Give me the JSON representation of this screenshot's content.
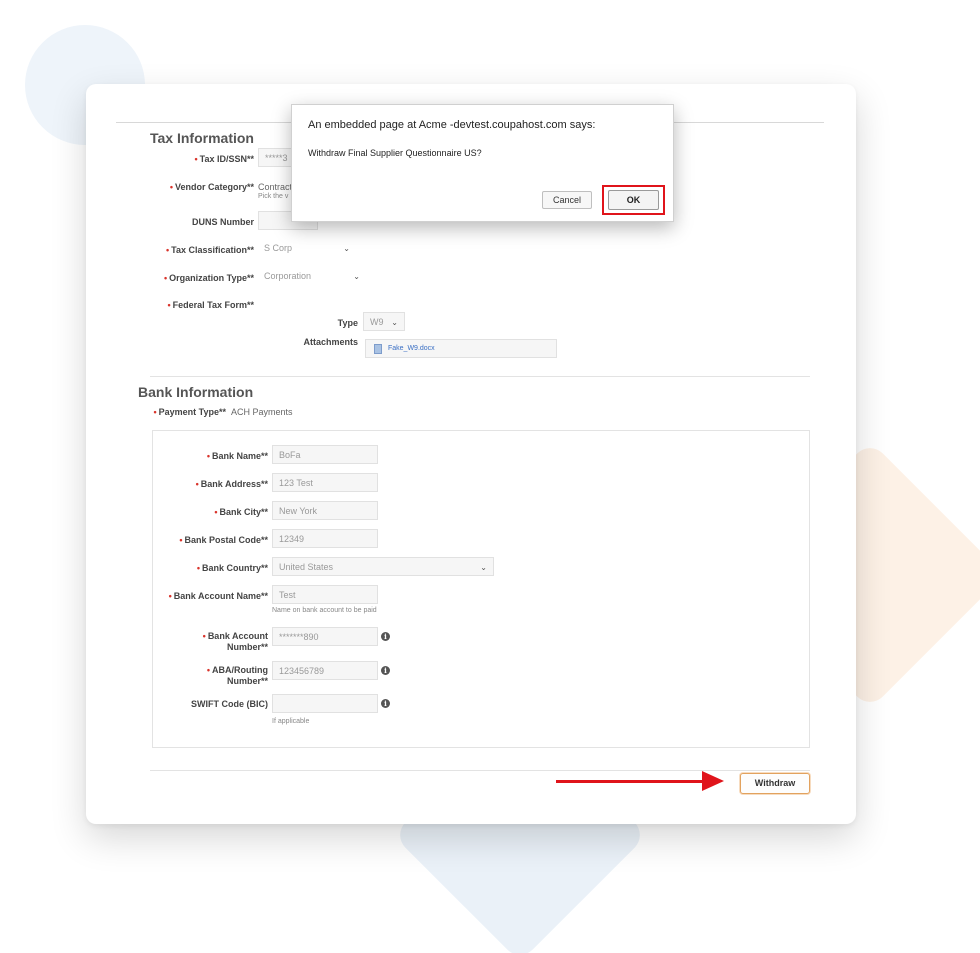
{
  "tax": {
    "title": "Tax Information",
    "tax_id_label": "Tax ID/SSN**",
    "tax_id_value": "*****3",
    "vendor_category_label": "Vendor Category**",
    "vendor_category_value": "Contract",
    "vendor_category_hint": "Pick the v",
    "duns_label": "DUNS Number",
    "duns_value": "",
    "tax_classification_label": "Tax Classification**",
    "tax_classification_value": "S Corp",
    "organization_type_label": "Organization Type**",
    "organization_type_value": "Corporation",
    "federal_tax_form_label": "Federal Tax Form**",
    "type_label": "Type",
    "type_value": "W9",
    "attachments_label": "Attachments",
    "attachment_file": "Fake_W9.docx"
  },
  "bank": {
    "title": "Bank Information",
    "payment_type_label": "Payment Type**",
    "payment_type_value": "ACH Payments",
    "bank_name_label": "Bank Name**",
    "bank_name_value": "BoFa",
    "bank_address_label": "Bank Address**",
    "bank_address_value": "123 Test",
    "bank_city_label": "Bank City**",
    "bank_city_value": "New York",
    "bank_postal_code_label": "Bank Postal Code**",
    "bank_postal_code_value": "12349",
    "bank_country_label": "Bank Country**",
    "bank_country_value": "United States",
    "bank_account_name_label": "Bank Account Name**",
    "bank_account_name_value": "Test",
    "bank_account_name_hint": "Name on bank account to be paid",
    "bank_account_number_label_1": "Bank Account",
    "bank_account_number_label_2": "Number**",
    "bank_account_number_value": "*******890",
    "aba_label_1": "ABA/Routing",
    "aba_label_2": "Number**",
    "aba_value": "123456789",
    "swift_label": "SWIFT Code (BIC)",
    "swift_value": "",
    "swift_hint": "If applicable"
  },
  "dialog": {
    "title": "An embedded page at Acme -devtest.coupahost.com says:",
    "message": "Withdraw Final Supplier Questionnaire US?",
    "cancel_label": "Cancel",
    "ok_label": "OK"
  },
  "footer": {
    "withdraw_label": "Withdraw"
  },
  "icons": {
    "info": "i",
    "chevron": "⌄"
  },
  "colors": {
    "required": "#d9342b",
    "highlight": "#e0141b",
    "withdraw_border": "#e2a25e"
  }
}
